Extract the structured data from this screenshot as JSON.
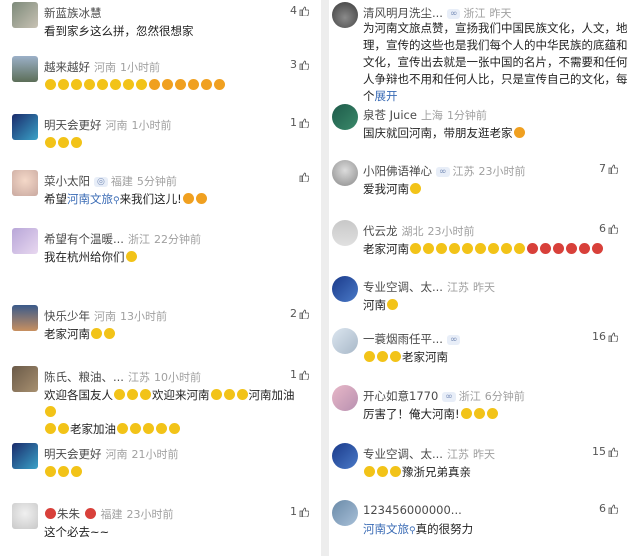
{
  "left": [
    {
      "name": "新蓝族冰慧",
      "loc": "",
      "time": "",
      "likes": "4",
      "text": "看到家乡这么拼，忽然很想家",
      "emoji": []
    },
    {
      "name": "越来越好",
      "loc": "河南",
      "time": "1小时前",
      "likes": "3",
      "text": "",
      "emoji": [
        "y",
        "y",
        "y",
        "y",
        "y",
        "y",
        "y",
        "y",
        "o",
        "o",
        "o",
        "o",
        "o",
        "o"
      ]
    },
    {
      "name": "明天会更好",
      "loc": "河南",
      "time": "1小时前",
      "likes": "1",
      "text": "",
      "emoji": [
        "y",
        "y",
        "y"
      ]
    },
    {
      "name": "菜小太阳",
      "badge": "◎",
      "loc": "福建",
      "time": "5分钟前",
      "likes": "1",
      "text_a": "希望",
      "link": "河南文旅",
      "text_b": "来我们这儿!",
      "emoji": [
        "o",
        "o"
      ]
    },
    {
      "name": "希望有个温暖...",
      "loc": "浙江",
      "time": "22分钟前",
      "likes": "",
      "text": "我在杭州给你们",
      "emoji": [
        "y"
      ]
    },
    {
      "name": "快乐少年",
      "loc": "河南",
      "time": "13小时前",
      "likes": "2",
      "text": "老家河南",
      "emoji": [
        "y",
        "y"
      ]
    },
    {
      "name": "陈氏、粮油、...",
      "loc": "江苏",
      "time": "10小时前",
      "likes": "1",
      "line1": "欢迎各国友人",
      "line1b": "欢迎来河南",
      "line1c": "河南加油",
      "line2": "老家加油",
      "emoji": []
    },
    {
      "name": "明天会更好",
      "loc": "河南",
      "time": "21小时前",
      "likes": "",
      "text": "",
      "emoji": [
        "y",
        "y",
        "y"
      ]
    },
    {
      "name": "朱朱",
      "loc": "福建",
      "time": "23小时前",
      "likes": "1",
      "text": "这个必去~~",
      "emoji": []
    }
  ],
  "right": [
    {
      "name": "清风明月洗尘...",
      "badge": "∞",
      "loc": "浙江",
      "time": "昨天",
      "likes": "",
      "text": "为河南文旅点赞，宣扬我们中国民族文化，人文，地理，宣传的这些也是我们每个人的中华民族的底蕴和文化，宣传出去就是一张中国的名片，不需要和任何人争辩也不用和任何人比，只是宣传自己的文化，每个",
      "expand": "展开"
    },
    {
      "name": "泉苍 Juice",
      "loc": "上海",
      "time": "1分钟前",
      "likes": "",
      "text": "国庆就回河南，带朋友逛老家",
      "emoji": [
        "o"
      ]
    },
    {
      "name": "小阳佛语禅心",
      "badge": "∞",
      "loc": "江苏",
      "time": "23小时前",
      "likes": "7",
      "text": "爱我河南",
      "emoji": [
        "y"
      ]
    },
    {
      "name": "代云龙",
      "loc": "湖北",
      "time": "23小时前",
      "likes": "6",
      "text": "老家河南",
      "emoji": [
        "y",
        "y",
        "y",
        "y",
        "y",
        "y",
        "y",
        "y",
        "y",
        "r",
        "r",
        "r",
        "r",
        "r",
        "r"
      ]
    },
    {
      "name": "专业空调、太...",
      "loc": "江苏",
      "time": "昨天",
      "likes": "",
      "text": "河南",
      "emoji": [
        "y"
      ]
    },
    {
      "name": "一蓑烟雨任平...",
      "badge": "∞",
      "loc": "",
      "time": "",
      "likes": "16",
      "text": "老家河南",
      "pre": [
        "y",
        "y",
        "y"
      ],
      "emoji": []
    },
    {
      "name": "开心如意1770",
      "badge": "∞",
      "loc": "浙江",
      "time": "6分钟前",
      "likes": "",
      "text": "厉害了！俺大河南!",
      "emoji": [
        "y",
        "y",
        "y"
      ]
    },
    {
      "name": "专业空调、太...",
      "loc": "江苏",
      "time": "昨天",
      "likes": "15",
      "text": "豫浙兄弟真亲",
      "pre": [
        "y",
        "y",
        "y"
      ],
      "emoji": []
    },
    {
      "name": "123456000000...",
      "loc": "",
      "time": "",
      "likes": "6",
      "link": "河南文旅",
      "text": "真的很努力",
      "emoji": []
    }
  ],
  "colors": {
    "link": "#3a6bb5",
    "text": "#222222",
    "meta": "#8a8a8a"
  },
  "icons": {
    "like": "thumb-up-icon",
    "link": "search-icon"
  }
}
